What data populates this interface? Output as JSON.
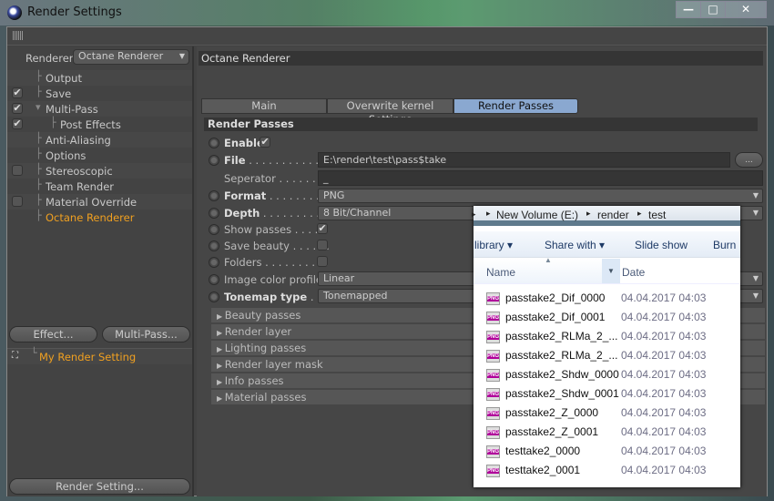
{
  "window": {
    "title": "Render Settings",
    "min": "—",
    "max": "□",
    "close": "✕"
  },
  "left": {
    "renderer_label": "Renderer",
    "renderer_value": "Octane Renderer",
    "tree": [
      {
        "label": "Output",
        "check": null
      },
      {
        "label": "Save",
        "check": true
      },
      {
        "label": "Multi-Pass",
        "check": true,
        "expanded": true
      },
      {
        "label": "Post Effects",
        "check": true,
        "indent": true
      },
      {
        "label": "Anti-Aliasing",
        "check": null
      },
      {
        "label": "Options",
        "check": null
      },
      {
        "label": "Stereoscopic",
        "check": false
      },
      {
        "label": "Team Render",
        "check": null
      },
      {
        "label": "Material Override",
        "check": false
      },
      {
        "label": "Octane Renderer",
        "check": null,
        "active": true
      }
    ],
    "effect_button": "Effect...",
    "multipass_button": "Multi-Pass...",
    "setting": "My Render Setting",
    "render_setting_button": "Render Setting..."
  },
  "right": {
    "header": "Octane Renderer",
    "tabs": [
      {
        "label": "Main"
      },
      {
        "label": "Overwrite kernel Settings"
      },
      {
        "label": "Render Passes",
        "active": true
      }
    ],
    "section": "Render Passes",
    "enable": {
      "label": "Enable",
      "checked": true
    },
    "file": {
      "label": "File",
      "dots": " . . . . . . . . . . . . .",
      "value": "E:\\render\\test\\pass$take",
      "browse": "..."
    },
    "separator": {
      "label": "Seperator",
      "dots": " . . . . . . . .",
      "value": "_"
    },
    "format": {
      "label": "Format",
      "dots": " . . . . . . . . . .",
      "value": "PNG"
    },
    "depth": {
      "label": "Depth",
      "dots": " . . . . . . . . . . .",
      "value": "8 Bit/Channel"
    },
    "show_passes": {
      "label": "Show passes",
      "dots": " . . . . .",
      "checked": true
    },
    "save_beauty": {
      "label": "Save beauty",
      "dots": " . . . . . .",
      "checked": false
    },
    "folders": {
      "label": "Folders",
      "dots": " . . . . . . . . . .",
      "checked": false
    },
    "color_profile": {
      "label": "Image color profile",
      "value": "Linear"
    },
    "tonemap": {
      "label": "Tonemap type",
      "dots": " . . . .",
      "value": "Tonemapped"
    },
    "groups": [
      "Beauty passes",
      "Render layer",
      "Lighting passes",
      "Render layer mask",
      "Info passes",
      "Material passes"
    ]
  },
  "explorer": {
    "breadcrumb": [
      "New Volume (E:)",
      "render",
      "test"
    ],
    "toolbar": [
      "library ▾",
      "Share with ▾",
      "Slide show",
      "Burn"
    ],
    "columns": [
      "Name",
      "Date"
    ],
    "files": [
      {
        "name": "passtake2_Dif_0000",
        "date": "04.04.2017 04:03"
      },
      {
        "name": "passtake2_Dif_0001",
        "date": "04.04.2017 04:03"
      },
      {
        "name": "passtake2_RLMa_2_...",
        "date": "04.04.2017 04:03"
      },
      {
        "name": "passtake2_RLMa_2_...",
        "date": "04.04.2017 04:03"
      },
      {
        "name": "passtake2_Shdw_0000",
        "date": "04.04.2017 04:03"
      },
      {
        "name": "passtake2_Shdw_0001",
        "date": "04.04.2017 04:03"
      },
      {
        "name": "passtake2_Z_0000",
        "date": "04.04.2017 04:03"
      },
      {
        "name": "passtake2_Z_0001",
        "date": "04.04.2017 04:03"
      },
      {
        "name": "testtake2_0000",
        "date": "04.04.2017 04:03"
      },
      {
        "name": "testtake2_0001",
        "date": "04.04.2017 04:03"
      }
    ],
    "file_icon": "PNG"
  },
  "colors": {
    "accent_orange": "#f0a020",
    "tab_active": "#8aa8d0"
  }
}
